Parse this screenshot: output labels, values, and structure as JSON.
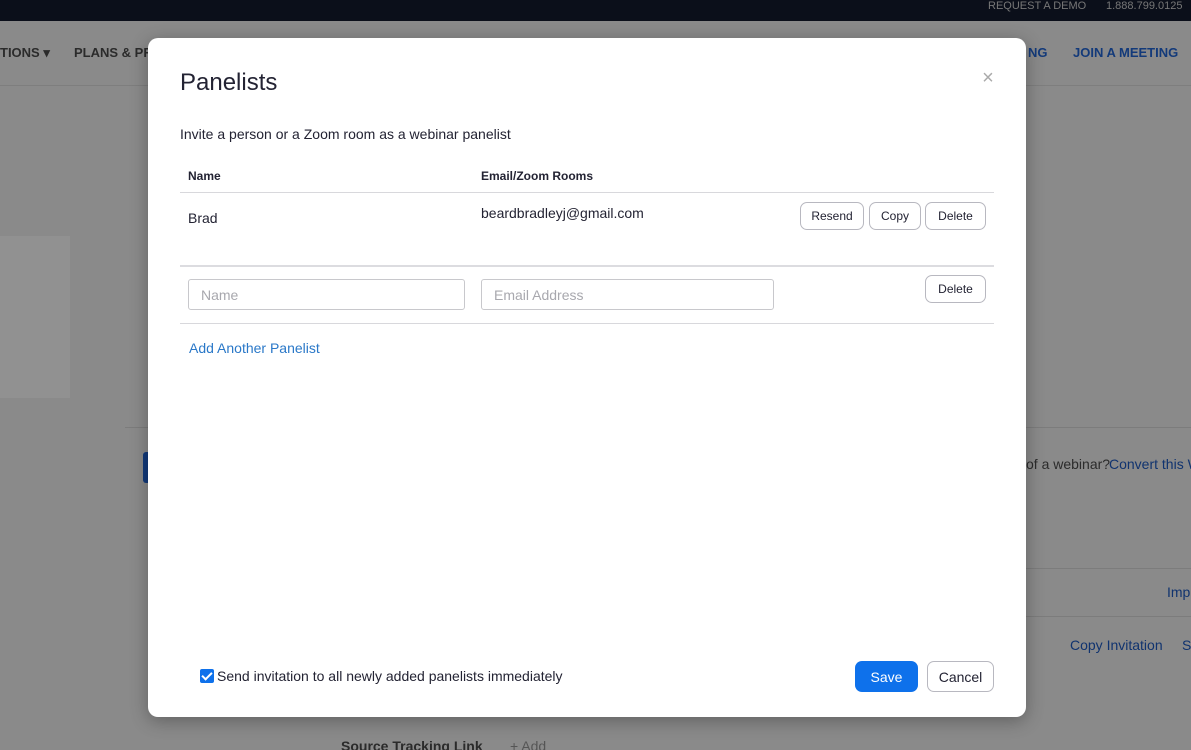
{
  "topbar": {
    "request_demo": "REQUEST A DEMO",
    "phone": "1.888.799.0125"
  },
  "nav": {
    "solutions_partial": "TIONS ▾",
    "plans_partial": "PLANS & PRI",
    "host_partial": "NG",
    "join": "JOIN A MEETING"
  },
  "background": {
    "convert_prompt": "of a webinar?",
    "convert_link": "Convert this W",
    "import_partial": "Imp",
    "copy_invitation": "Copy Invitation",
    "s_partial": "S",
    "source_tracking": "Source Tracking Link",
    "add": "+ Add"
  },
  "modal": {
    "title": "Panelists",
    "close_label": "×",
    "subtitle": "Invite a person or a Zoom room as a webinar panelist",
    "columns": {
      "name": "Name",
      "email": "Email/Zoom Rooms"
    },
    "panelists": [
      {
        "name": "Brad",
        "email": "beardbradleyj@gmail.com",
        "resend": "Resend",
        "copy": "Copy",
        "delete": "Delete"
      }
    ],
    "new_row": {
      "name_placeholder": "Name",
      "email_placeholder": "Email Address",
      "delete": "Delete"
    },
    "add_another": "Add Another Panelist",
    "send_invitation": {
      "checked": true,
      "label": "Send invitation to all newly added panelists immediately"
    },
    "save": "Save",
    "cancel": "Cancel"
  },
  "colors": {
    "primary": "#0e71eb",
    "link": "#2a78c8",
    "overlay": "#8a8a8a"
  }
}
